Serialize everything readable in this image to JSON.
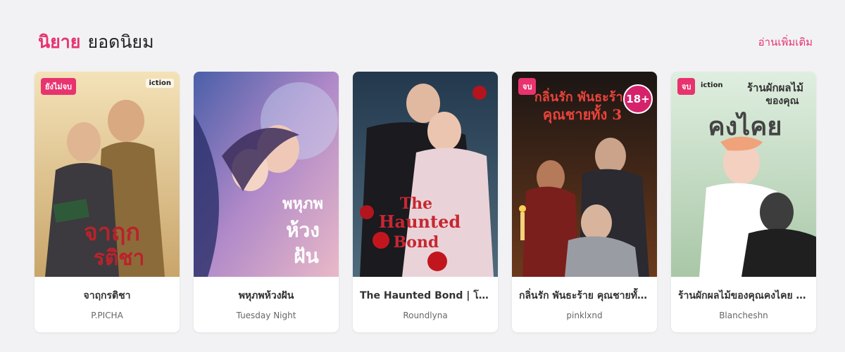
{
  "header": {
    "title_accent": "นิยาย",
    "title_rest": "ยอดนิยม",
    "read_more": "อ่านเพิ่มเติม"
  },
  "cards": [
    {
      "title": "จาฤกรติชา",
      "author": "P.PICHA",
      "status": "ยังไม่จบ",
      "brand": "iction",
      "cover_text": "จาฤก รติชา"
    },
    {
      "title": "พหุภพห้วงฝัน",
      "author": "Tuesday Night",
      "cover_text": "พหุภพ ห้วงฝัน"
    },
    {
      "title": "The Haunted Bond | โสย...",
      "author": "Roundlyna",
      "cover_text": "The Haunted Bond"
    },
    {
      "title": "กลิ่นรัก พันธะร้าย คุณชายทั้ง...",
      "author": "pinklxnd",
      "status": "จบ",
      "age": "18+",
      "cover_text": "กลิ่นรัก พันธะร้าย คุณชายทั้ง 3"
    },
    {
      "title": "ร้านผักผลไม้ของคุณคงไคย (...",
      "author": "Blancheshn",
      "status": "จบ",
      "brand": "iction",
      "cover_text": "ร้านผักผลไม้ ของคุณ คงไคย"
    }
  ],
  "colors": {
    "accent": "#e8336f",
    "background": "#f2f2f4"
  }
}
